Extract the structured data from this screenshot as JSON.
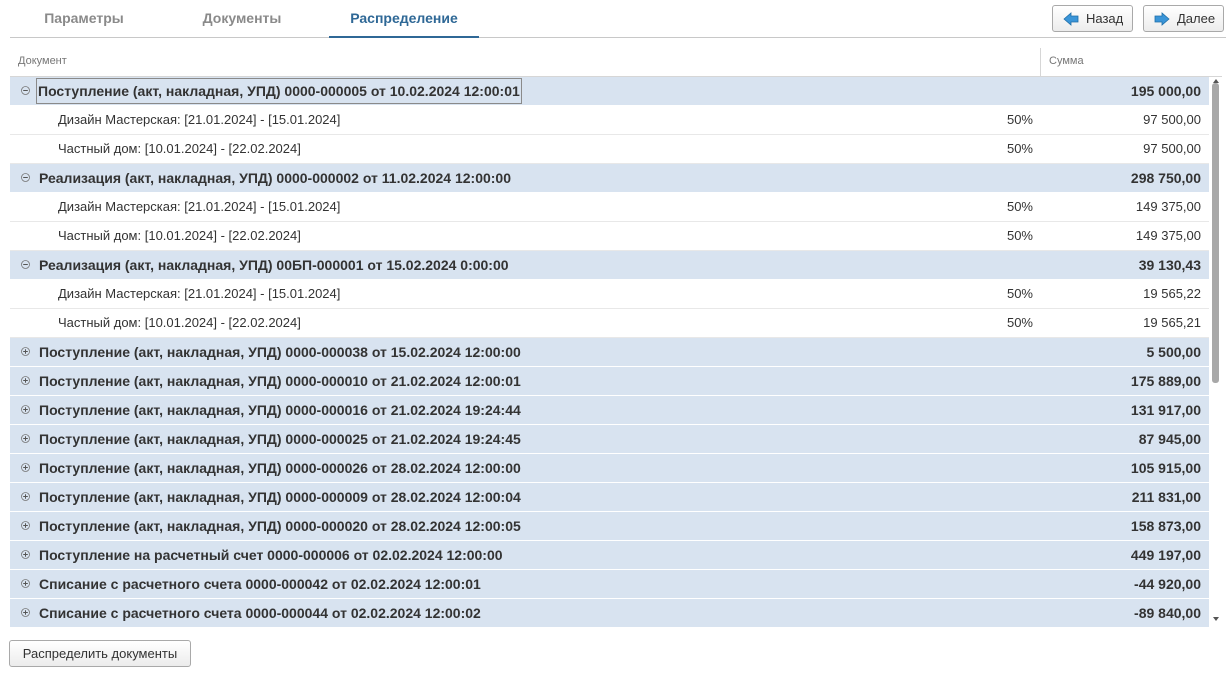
{
  "tabs": [
    {
      "label": "Параметры",
      "active": false
    },
    {
      "label": "Документы",
      "active": false
    },
    {
      "label": "Распределение",
      "active": true
    }
  ],
  "nav": {
    "back_label": "Назад",
    "next_label": "Далее",
    "arrow_color": "#3a95d8"
  },
  "grid": {
    "col_document": "Документ",
    "col_sum": "Сумма",
    "rows": [
      {
        "kind": "group",
        "expanded": true,
        "text": "Поступление (акт, накладная, УПД) 0000-000005 от 10.02.2024 12:00:01",
        "sum": "195 000,00",
        "focused": true
      },
      {
        "kind": "child",
        "text": "Дизайн Мастерская: [21.01.2024] - [15.01.2024]",
        "pct": "50%",
        "sum": "97 500,00"
      },
      {
        "kind": "child",
        "text": "Частный дом: [10.01.2024] - [22.02.2024]",
        "pct": "50%",
        "sum": "97 500,00"
      },
      {
        "kind": "group",
        "expanded": true,
        "text": "Реализация (акт, накладная, УПД) 0000-000002 от 11.02.2024 12:00:00",
        "sum": "298 750,00"
      },
      {
        "kind": "child",
        "text": "Дизайн Мастерская: [21.01.2024] - [15.01.2024]",
        "pct": "50%",
        "sum": "149 375,00"
      },
      {
        "kind": "child",
        "text": "Частный дом: [10.01.2024] - [22.02.2024]",
        "pct": "50%",
        "sum": "149 375,00"
      },
      {
        "kind": "group",
        "expanded": true,
        "text": "Реализация (акт, накладная, УПД) 00БП-000001 от 15.02.2024 0:00:00",
        "sum": "39 130,43"
      },
      {
        "kind": "child",
        "text": "Дизайн Мастерская: [21.01.2024] - [15.01.2024]",
        "pct": "50%",
        "sum": "19 565,22"
      },
      {
        "kind": "child",
        "text": "Частный дом: [10.01.2024] - [22.02.2024]",
        "pct": "50%",
        "sum": "19 565,21"
      },
      {
        "kind": "group",
        "expanded": false,
        "text": "Поступление (акт, накладная, УПД) 0000-000038 от 15.02.2024 12:00:00",
        "sum": "5 500,00"
      },
      {
        "kind": "group",
        "expanded": false,
        "text": "Поступление (акт, накладная, УПД) 0000-000010 от 21.02.2024 12:00:01",
        "sum": "175 889,00"
      },
      {
        "kind": "group",
        "expanded": false,
        "text": "Поступление (акт, накладная, УПД) 0000-000016 от 21.02.2024 19:24:44",
        "sum": "131 917,00"
      },
      {
        "kind": "group",
        "expanded": false,
        "text": "Поступление (акт, накладная, УПД) 0000-000025 от 21.02.2024 19:24:45",
        "sum": "87 945,00"
      },
      {
        "kind": "group",
        "expanded": false,
        "text": "Поступление (акт, накладная, УПД) 0000-000026 от 28.02.2024 12:00:00",
        "sum": "105 915,00"
      },
      {
        "kind": "group",
        "expanded": false,
        "text": "Поступление (акт, накладная, УПД) 0000-000009 от 28.02.2024 12:00:04",
        "sum": "211 831,00"
      },
      {
        "kind": "group",
        "expanded": false,
        "text": "Поступление (акт, накладная, УПД) 0000-000020 от 28.02.2024 12:00:05",
        "sum": "158 873,00"
      },
      {
        "kind": "group",
        "expanded": false,
        "text": "Поступление на расчетный счет 0000-000006 от 02.02.2024 12:00:00",
        "sum": "449 197,00"
      },
      {
        "kind": "group",
        "expanded": false,
        "text": "Списание с расчетного счета 0000-000042 от 02.02.2024 12:00:01",
        "sum": "-44 920,00"
      },
      {
        "kind": "group",
        "expanded": false,
        "text": "Списание с расчетного счета 0000-000044 от 02.02.2024 12:00:02",
        "sum": "-89 840,00"
      }
    ]
  },
  "footer": {
    "distribute_label": "Распределить документы"
  },
  "colors": {
    "active_tab": "#2f6896",
    "group_row_bg": "#d8e3f0"
  },
  "icons": {
    "expanded": "minus-circle-icon",
    "collapsed": "plus-circle-icon",
    "back": "arrow-left-icon",
    "next": "arrow-right-icon"
  }
}
